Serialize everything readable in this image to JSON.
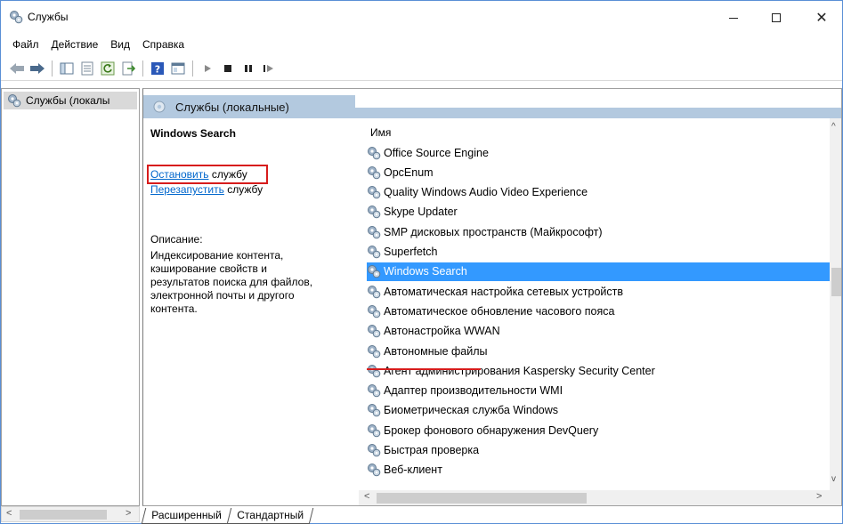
{
  "window": {
    "title": "Службы"
  },
  "menu": [
    "Файл",
    "Действие",
    "Вид",
    "Справка"
  ],
  "tree": {
    "item": "Службы (локалы"
  },
  "content": {
    "header": "Службы (локальные)",
    "detail": {
      "service_name": "Windows Search",
      "stop_link": "Остановить",
      "stop_suffix": " службу",
      "restart_link": "Перезапустить",
      "restart_suffix": " службу",
      "description_label": "Описание:",
      "description": "Индексирование контента, кэширование свойств и результатов поиска для файлов, электронной почты и другого контента."
    },
    "list": {
      "column_header": "Имя",
      "rows": [
        "Office  Source Engine",
        "OpcEnum",
        "Quality Windows Audio Video Experience",
        "Skype Updater",
        "SMP дисковых пространств (Майкрософт)",
        "Superfetch",
        "Windows Search",
        "Автоматическая настройка сетевых устройств",
        "Автоматическое обновление часового пояса",
        "Автонастройка WWAN",
        "Автономные файлы",
        "Агент администрирования Kaspersky Security Center",
        "Адаптер производительности WMI",
        "Биометрическая служба Windows",
        "Брокер фонового обнаружения DevQuery",
        "Быстрая проверка",
        "Веб-клиент"
      ],
      "selected": "Windows Search"
    }
  },
  "tabs": [
    "Расширенный",
    "Стандартный"
  ],
  "colors": {
    "selection": "#3399ff",
    "header_band": "#b3c9df",
    "highlight_box": "#d71c1c",
    "link": "#0066cc"
  }
}
